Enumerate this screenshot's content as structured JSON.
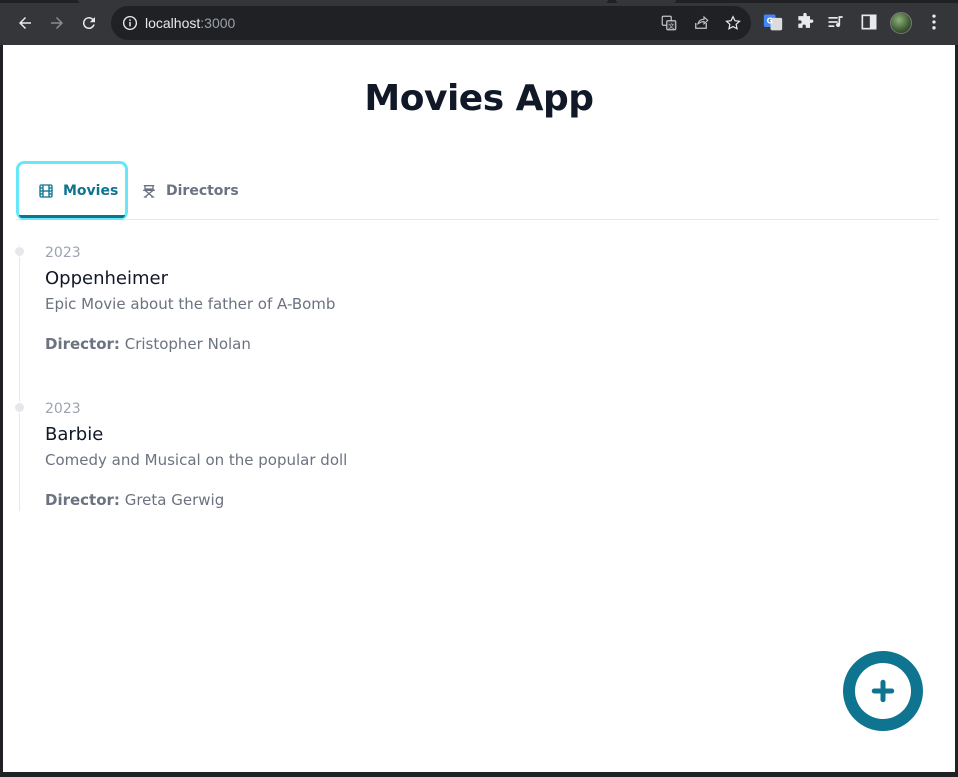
{
  "browser": {
    "url_host": "localhost",
    "url_port": ":3000"
  },
  "app": {
    "title": "Movies App"
  },
  "tabs": [
    {
      "label": "Movies",
      "icon": "film-icon",
      "active": true
    },
    {
      "label": "Directors",
      "icon": "director-chair-icon",
      "active": false
    }
  ],
  "movies": [
    {
      "year": "2023",
      "title": "Oppenheimer",
      "description": "Epic Movie about the father of A-Bomb",
      "director_label": "Director:",
      "director": "Cristopher Nolan"
    },
    {
      "year": "2023",
      "title": "Barbie",
      "description": "Comedy and Musical on the popular doll",
      "director_label": "Director:",
      "director": "Greta Gerwig"
    }
  ],
  "colors": {
    "accent": "#0e7490",
    "focus_ring": "#67e8f9",
    "title": "#111827",
    "muted": "#6b7280"
  },
  "fab": {
    "icon": "plus-circle-icon"
  }
}
